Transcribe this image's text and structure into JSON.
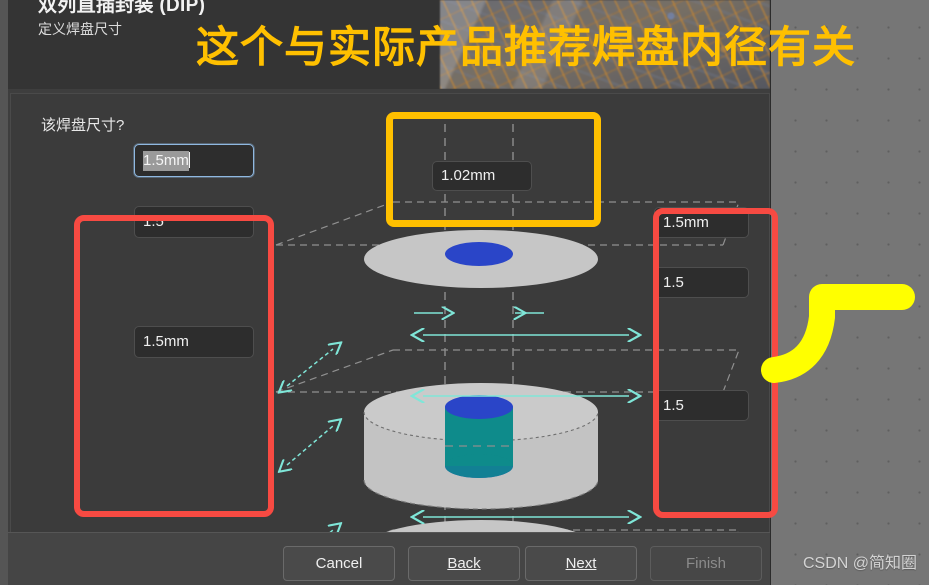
{
  "window": {
    "banner": {
      "title": "双列直插封装 (DIP)",
      "subtitle": "定义焊盘尺寸",
      "art_icon": "circuit-board-photo"
    },
    "content": {
      "question": "该焊盘尺寸?",
      "fields": {
        "top_center": {
          "value": "1.02mm"
        },
        "left_1": {
          "value": "1.5mm",
          "focused": true,
          "selected": true
        },
        "left_2": {
          "value": "1.5"
        },
        "left_3": {
          "value": "1.5mm"
        },
        "right_1": {
          "value": "1.5mm"
        },
        "right_2": {
          "value": "1.5"
        },
        "right_3": {
          "value": "1.5"
        }
      },
      "diagram": {
        "name": "dip-pad-3d-diagram",
        "pad_color": "#c6c6c6",
        "hole_color": "#2a45c8",
        "barrel_color": "#0e8b8b",
        "dimension_arrow_color": "#7fe6d8",
        "guide_line_color": "#9a9a9a"
      }
    },
    "footer": {
      "buttons": [
        {
          "label": "Cancel",
          "accel": "",
          "disabled": false
        },
        {
          "label": "Back",
          "accel": "B",
          "disabled": false
        },
        {
          "label": "Next",
          "accel": "N",
          "disabled": false
        },
        {
          "label": "Finish",
          "accel": "",
          "disabled": true
        }
      ]
    }
  },
  "annotations": {
    "headline": "这个与实际产品推荐焊盘内径有关",
    "headline_color": "#ffc000",
    "red_box_color": "#f74a42",
    "yellow_box_color": "#ffc000",
    "yellow_arrow_color": "#ffff00"
  },
  "watermark": "CSDN @简知圈"
}
